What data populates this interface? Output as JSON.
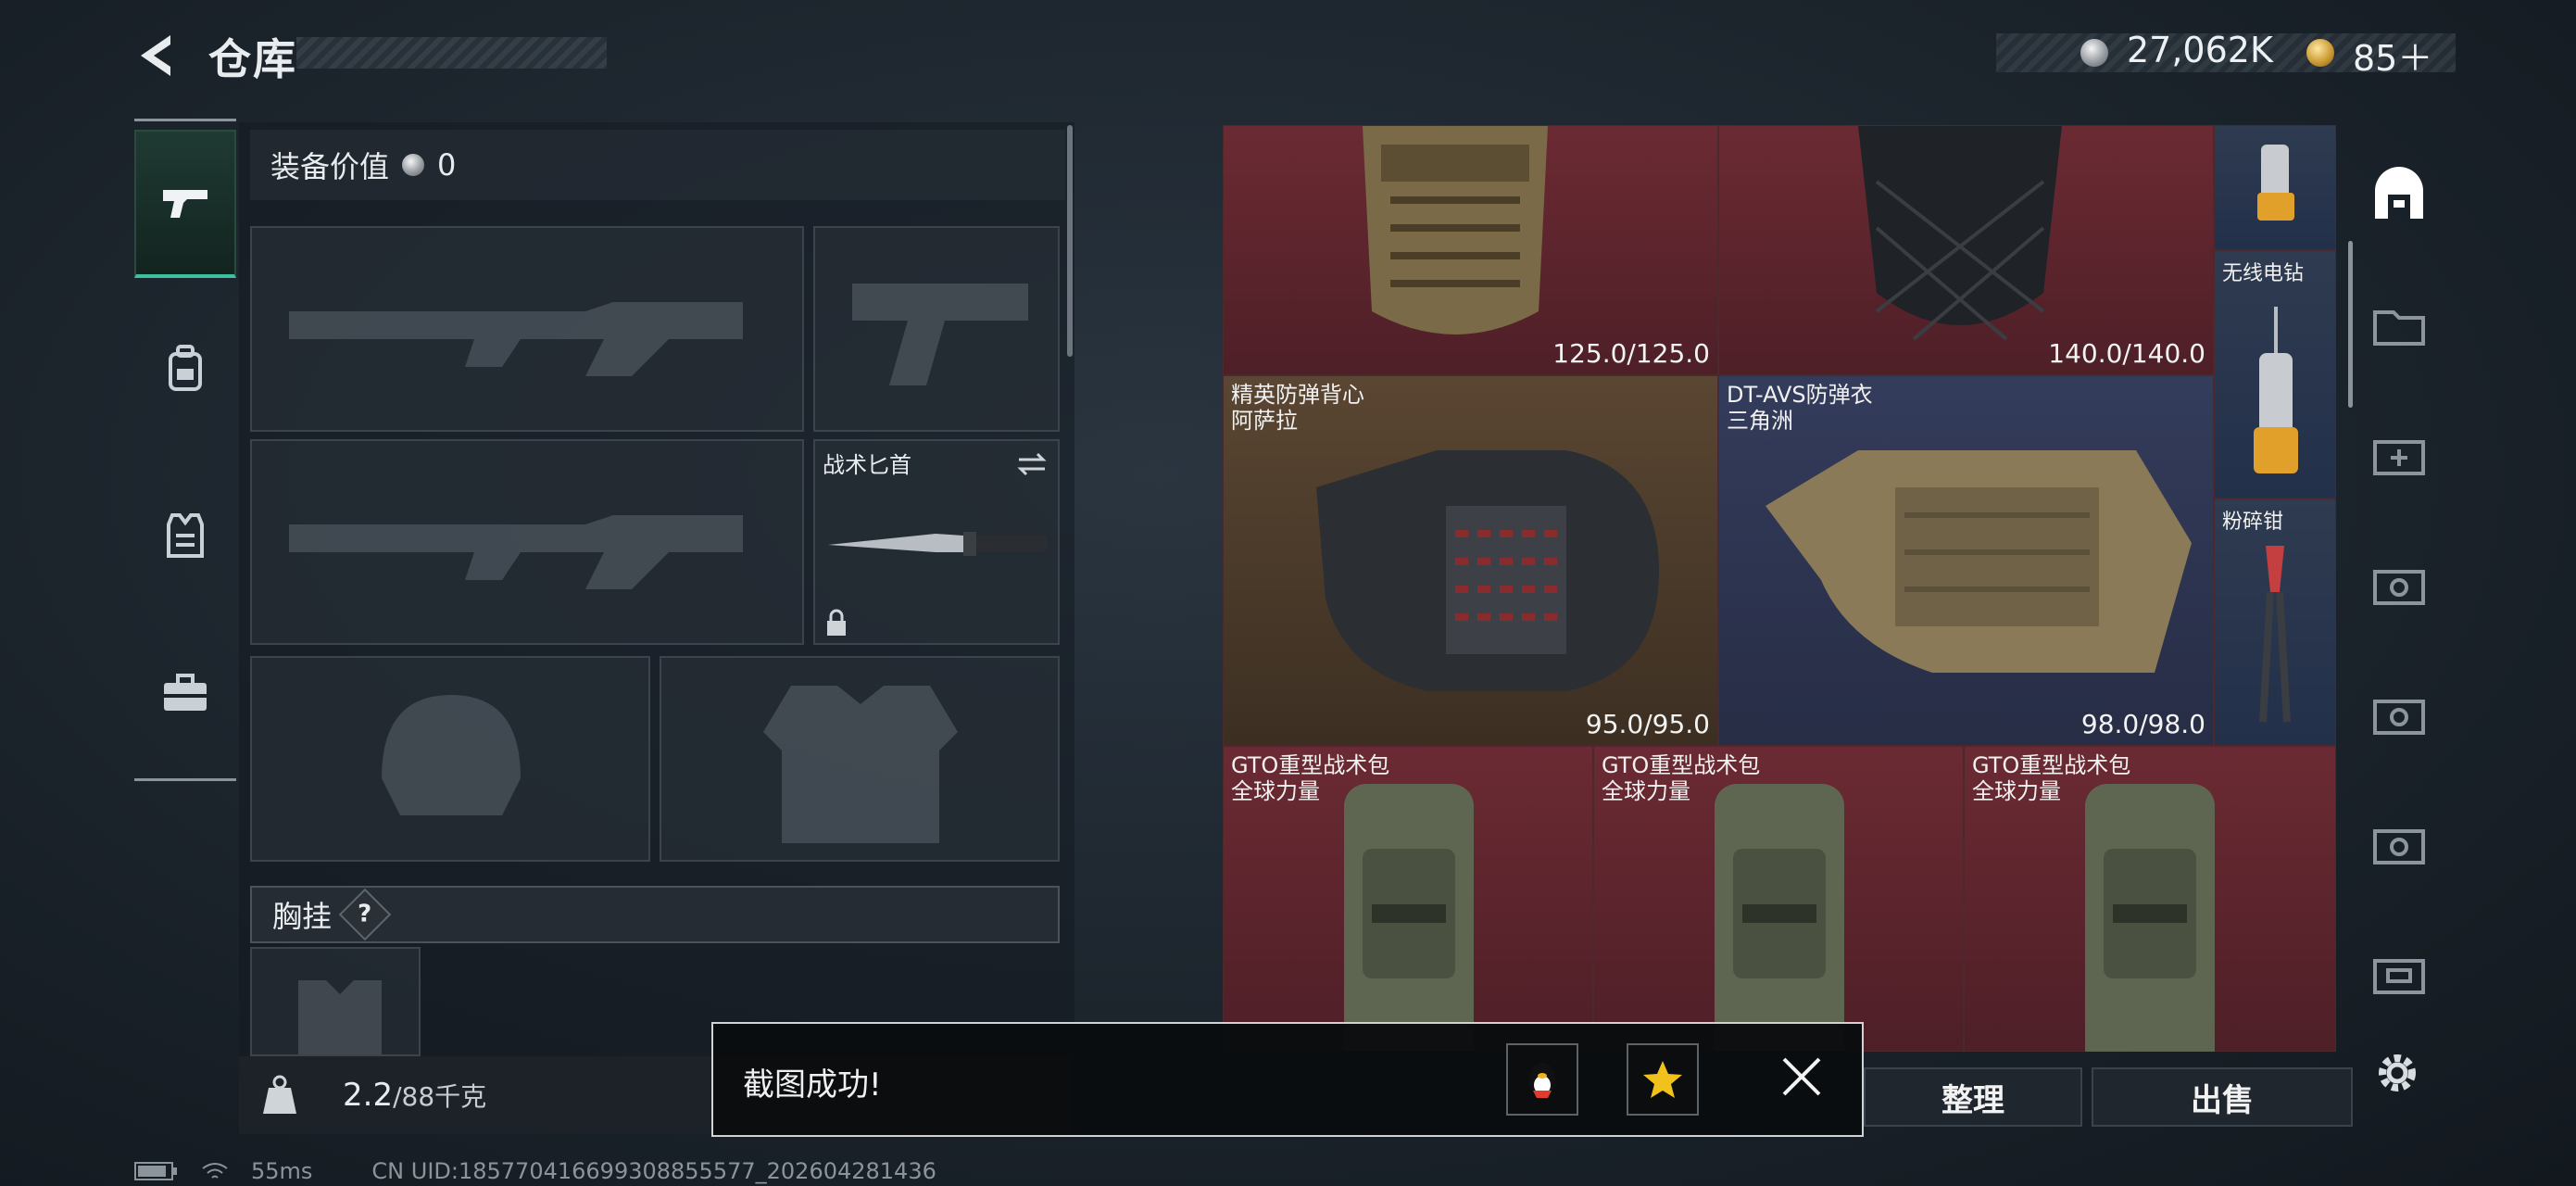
{
  "header": {
    "title": "仓库",
    "currencies": [
      {
        "icon": "silver-coin-icon",
        "value": "27,062K"
      },
      {
        "icon": "gold-coin-icon",
        "value": "85＋"
      }
    ]
  },
  "left_rail": {
    "items": [
      {
        "icon": "pistol-icon",
        "active": true
      },
      {
        "icon": "backpack-icon",
        "active": false
      },
      {
        "icon": "vest-icon",
        "active": false
      },
      {
        "icon": "toolbox-icon",
        "active": false
      }
    ]
  },
  "equipment": {
    "value_label": "装备价值",
    "value": "0",
    "knife_label": "战术匕首",
    "chest_label": "胸挂",
    "chest_help": "?",
    "weight": "2.2",
    "weight_max": "/88千克"
  },
  "inventory": {
    "items": [
      {
        "name": "",
        "durability": "125.0/125.0",
        "rarity": "red"
      },
      {
        "name": "",
        "durability": "140.0/140.0",
        "rarity": "red"
      },
      {
        "name": "精英防弹背心\n阿萨拉",
        "durability": "95.0/95.0",
        "rarity": "gold"
      },
      {
        "name": "DT-AVS防弹衣\n三角洲",
        "durability": "98.0/98.0",
        "rarity": "blue"
      },
      {
        "name": "GTO重型战术包\n全球力量",
        "durability": "",
        "rarity": "red"
      },
      {
        "name": "GTO重型战术包\n全球力量",
        "durability": "",
        "rarity": "red"
      },
      {
        "name": "GTO重型战术包\n全球力量",
        "durability": "",
        "rarity": "red"
      },
      {
        "name": "无线电钻",
        "durability": "",
        "rarity": "slate"
      },
      {
        "name": "粉碎钳",
        "durability": "",
        "rarity": "slate"
      }
    ]
  },
  "actions": {
    "sort": "整理",
    "sell": "出售"
  },
  "toast": {
    "message": "截图成功!"
  },
  "status": {
    "ping": "55ms",
    "uid": "CN UID:185770416699308855577_202604281436"
  },
  "colors": {
    "accent": "#3fbfa1",
    "rarity_red": "#6b2a33",
    "rarity_gold": "#5a4632",
    "rarity_blue": "#343c5c"
  }
}
